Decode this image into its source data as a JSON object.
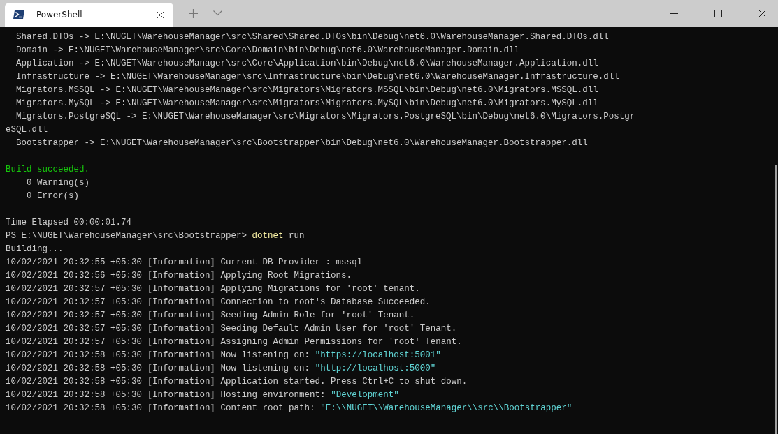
{
  "tabs": [
    {
      "label": "PowerShell",
      "selected": true
    }
  ],
  "terminal": {
    "blocks": [
      {
        "lines": [
          {
            "segments": [
              {
                "kind": "plain",
                "text": "  Shared.DTOs -> E:\\NUGET\\WarehouseManager\\src\\Shared\\Shared.DTOs\\bin\\Debug\\net6.0\\WarehouseManager.Shared.DTOs.dll"
              }
            ]
          },
          {
            "segments": [
              {
                "kind": "plain",
                "text": "  Domain -> E:\\NUGET\\WarehouseManager\\src\\Core\\Domain\\bin\\Debug\\net6.0\\WarehouseManager.Domain.dll"
              }
            ]
          },
          {
            "segments": [
              {
                "kind": "plain",
                "text": "  Application -> E:\\NUGET\\WarehouseManager\\src\\Core\\Application\\bin\\Debug\\net6.0\\WarehouseManager.Application.dll"
              }
            ]
          },
          {
            "segments": [
              {
                "kind": "plain",
                "text": "  Infrastructure -> E:\\NUGET\\WarehouseManager\\src\\Infrastructure\\bin\\Debug\\net6.0\\WarehouseManager.Infrastructure.dll"
              }
            ]
          },
          {
            "segments": [
              {
                "kind": "plain",
                "text": "  Migrators.MSSQL -> E:\\NUGET\\WarehouseManager\\src\\Migrators\\Migrators.MSSQL\\bin\\Debug\\net6.0\\Migrators.MSSQL.dll"
              }
            ]
          },
          {
            "segments": [
              {
                "kind": "plain",
                "text": "  Migrators.MySQL -> E:\\NUGET\\WarehouseManager\\src\\Migrators\\Migrators.MySQL\\bin\\Debug\\net6.0\\Migrators.MySQL.dll"
              }
            ]
          },
          {
            "segments": [
              {
                "kind": "plain",
                "text": "  Migrators.PostgreSQL -> E:\\NUGET\\WarehouseManager\\src\\Migrators\\Migrators.PostgreSQL\\bin\\Debug\\net6.0\\Migrators.Postgr"
              }
            ]
          },
          {
            "segments": [
              {
                "kind": "plain",
                "text": "eSQL.dll"
              }
            ]
          },
          {
            "segments": [
              {
                "kind": "plain",
                "text": "  Bootstrapper -> E:\\NUGET\\WarehouseManager\\src\\Bootstrapper\\bin\\Debug\\net6.0\\WarehouseManager.Bootstrapper.dll"
              }
            ]
          }
        ]
      },
      {
        "lines": [
          {
            "segments": [
              {
                "kind": "success",
                "text": "Build succeeded."
              }
            ]
          },
          {
            "segments": [
              {
                "kind": "plain",
                "text": "    0 Warning(s)"
              }
            ]
          },
          {
            "segments": [
              {
                "kind": "plain",
                "text": "    0 Error(s)"
              }
            ]
          }
        ]
      },
      {
        "lines": [
          {
            "segments": [
              {
                "kind": "plain",
                "text": "Time Elapsed 00:00:01.74"
              }
            ]
          },
          {
            "segments": [
              {
                "kind": "plain",
                "text": "PS E:\\NUGET\\WarehouseManager\\src\\Bootstrapper> "
              },
              {
                "kind": "command",
                "text": "dotnet"
              },
              {
                "kind": "plain",
                "text": " run"
              }
            ]
          },
          {
            "segments": [
              {
                "kind": "plain",
                "text": "Building..."
              }
            ]
          },
          {
            "segments": [
              {
                "kind": "plain",
                "text": "10/02/2021 20:32:55 +05:30 "
              },
              {
                "kind": "bracket",
                "text": "["
              },
              {
                "kind": "plain",
                "text": "Information"
              },
              {
                "kind": "bracket",
                "text": "]"
              },
              {
                "kind": "plain",
                "text": " Current DB Provider : mssql"
              }
            ]
          },
          {
            "segments": [
              {
                "kind": "plain",
                "text": "10/02/2021 20:32:56 +05:30 "
              },
              {
                "kind": "bracket",
                "text": "["
              },
              {
                "kind": "plain",
                "text": "Information"
              },
              {
                "kind": "bracket",
                "text": "]"
              },
              {
                "kind": "plain",
                "text": " Applying Root Migrations."
              }
            ]
          },
          {
            "segments": [
              {
                "kind": "plain",
                "text": "10/02/2021 20:32:57 +05:30 "
              },
              {
                "kind": "bracket",
                "text": "["
              },
              {
                "kind": "plain",
                "text": "Information"
              },
              {
                "kind": "bracket",
                "text": "]"
              },
              {
                "kind": "plain",
                "text": " Applying Migrations for 'root' tenant."
              }
            ]
          },
          {
            "segments": [
              {
                "kind": "plain",
                "text": "10/02/2021 20:32:57 +05:30 "
              },
              {
                "kind": "bracket",
                "text": "["
              },
              {
                "kind": "plain",
                "text": "Information"
              },
              {
                "kind": "bracket",
                "text": "]"
              },
              {
                "kind": "plain",
                "text": " Connection to root's Database Succeeded."
              }
            ]
          },
          {
            "segments": [
              {
                "kind": "plain",
                "text": "10/02/2021 20:32:57 +05:30 "
              },
              {
                "kind": "bracket",
                "text": "["
              },
              {
                "kind": "plain",
                "text": "Information"
              },
              {
                "kind": "bracket",
                "text": "]"
              },
              {
                "kind": "plain",
                "text": " Seeding Admin Role for 'root' Tenant."
              }
            ]
          },
          {
            "segments": [
              {
                "kind": "plain",
                "text": "10/02/2021 20:32:57 +05:30 "
              },
              {
                "kind": "bracket",
                "text": "["
              },
              {
                "kind": "plain",
                "text": "Information"
              },
              {
                "kind": "bracket",
                "text": "]"
              },
              {
                "kind": "plain",
                "text": " Seeding Default Admin User for 'root' Tenant."
              }
            ]
          },
          {
            "segments": [
              {
                "kind": "plain",
                "text": "10/02/2021 20:32:57 +05:30 "
              },
              {
                "kind": "bracket",
                "text": "["
              },
              {
                "kind": "plain",
                "text": "Information"
              },
              {
                "kind": "bracket",
                "text": "]"
              },
              {
                "kind": "plain",
                "text": " Assigning Admin Permissions for 'root' Tenant."
              }
            ]
          },
          {
            "segments": [
              {
                "kind": "plain",
                "text": "10/02/2021 20:32:58 +05:30 "
              },
              {
                "kind": "bracket",
                "text": "["
              },
              {
                "kind": "plain",
                "text": "Information"
              },
              {
                "kind": "bracket",
                "text": "]"
              },
              {
                "kind": "plain",
                "text": " Now listening on: "
              },
              {
                "kind": "string",
                "text": "\"https://localhost:5001\""
              }
            ]
          },
          {
            "segments": [
              {
                "kind": "plain",
                "text": "10/02/2021 20:32:58 +05:30 "
              },
              {
                "kind": "bracket",
                "text": "["
              },
              {
                "kind": "plain",
                "text": "Information"
              },
              {
                "kind": "bracket",
                "text": "]"
              },
              {
                "kind": "plain",
                "text": " Now listening on: "
              },
              {
                "kind": "string",
                "text": "\"http://localhost:5000\""
              }
            ]
          },
          {
            "segments": [
              {
                "kind": "plain",
                "text": "10/02/2021 20:32:58 +05:30 "
              },
              {
                "kind": "bracket",
                "text": "["
              },
              {
                "kind": "plain",
                "text": "Information"
              },
              {
                "kind": "bracket",
                "text": "]"
              },
              {
                "kind": "plain",
                "text": " Application started. Press Ctrl+C to shut down."
              }
            ]
          },
          {
            "segments": [
              {
                "kind": "plain",
                "text": "10/02/2021 20:32:58 +05:30 "
              },
              {
                "kind": "bracket",
                "text": "["
              },
              {
                "kind": "plain",
                "text": "Information"
              },
              {
                "kind": "bracket",
                "text": "]"
              },
              {
                "kind": "plain",
                "text": " Hosting environment: "
              },
              {
                "kind": "string",
                "text": "\"Development\""
              }
            ]
          },
          {
            "segments": [
              {
                "kind": "plain",
                "text": "10/02/2021 20:32:58 +05:30 "
              },
              {
                "kind": "bracket",
                "text": "["
              },
              {
                "kind": "plain",
                "text": "Information"
              },
              {
                "kind": "bracket",
                "text": "]"
              },
              {
                "kind": "plain",
                "text": " Content root path: "
              },
              {
                "kind": "string",
                "text": "\"E:\\\\NUGET\\\\WarehouseManager\\\\src\\\\Bootstrapper\""
              }
            ]
          }
        ]
      }
    ]
  }
}
